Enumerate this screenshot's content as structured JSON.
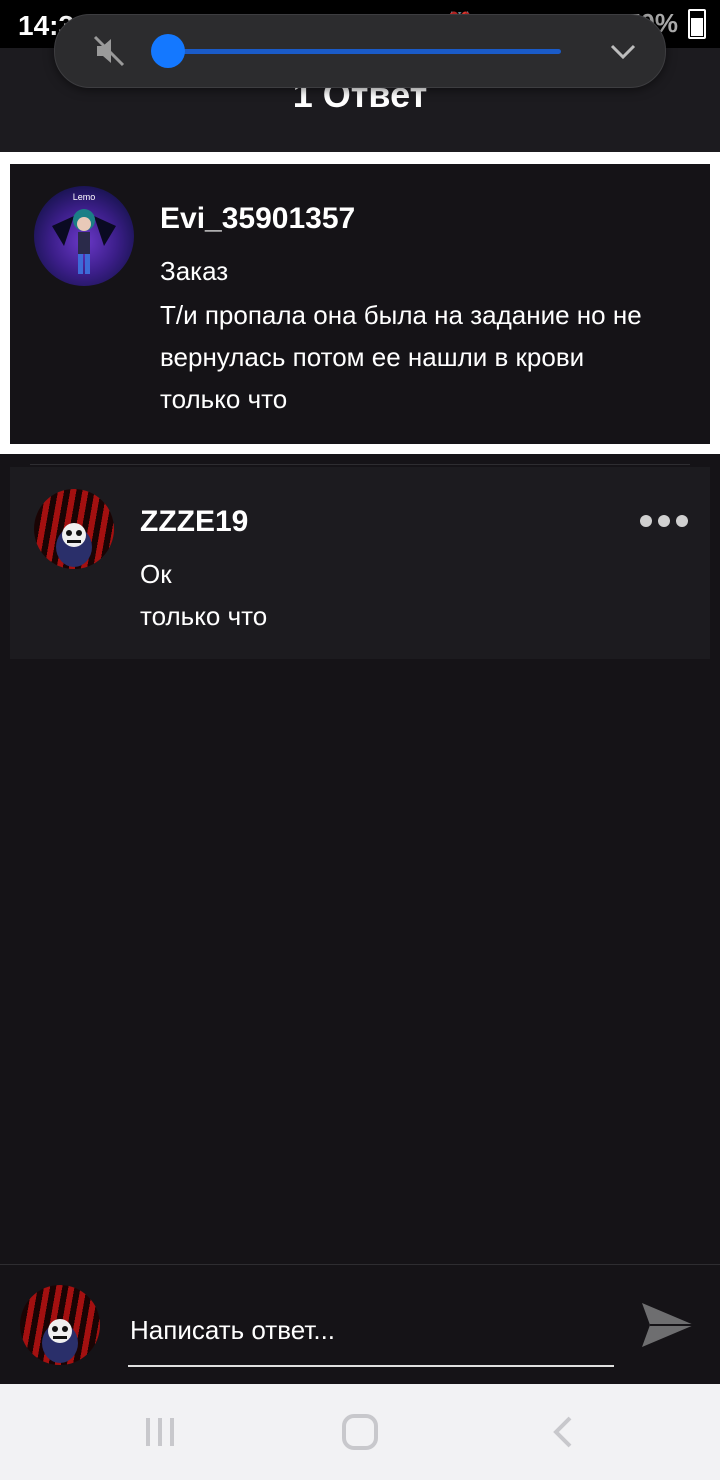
{
  "status_bar": {
    "time": "14:38",
    "battery": "70%"
  },
  "header": {
    "title": "1 Ответ"
  },
  "volume": {
    "level": 0.0
  },
  "original_post": {
    "author": "Evi_35901357",
    "lines": [
      "Заказ",
      "Т/и пропала она была на задание но не",
      "вернулась потом ее нашли в крови"
    ],
    "time": "только что",
    "avatar_text": "Lemo"
  },
  "reply": {
    "author": "ZZZE19",
    "text": "Ок",
    "time": "только что"
  },
  "compose": {
    "placeholder": "Написать ответ..."
  },
  "colors": {
    "accent": "#1478ff",
    "background": "#151317",
    "card": "#1c1b1f"
  }
}
